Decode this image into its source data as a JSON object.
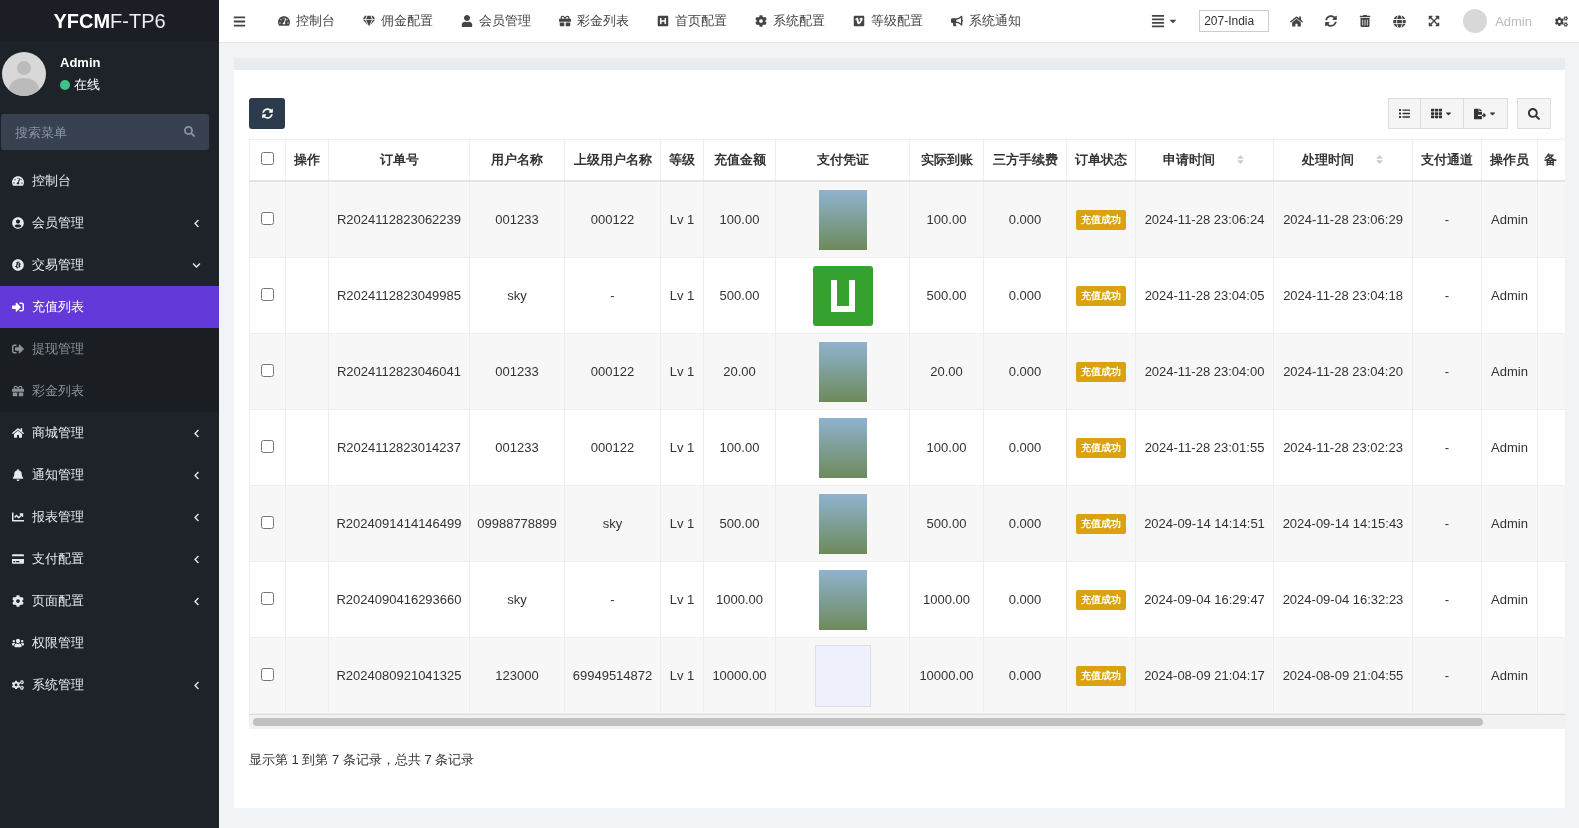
{
  "sidebar": {
    "logo": {
      "bold": "YFCM",
      "light": "F-TP6"
    },
    "user": {
      "name": "Admin",
      "status": "在线"
    },
    "search": {
      "placeholder": "搜索菜单"
    },
    "items": [
      {
        "label": "控制台",
        "kind": "link",
        "selected": false
      },
      {
        "label": "会员管理",
        "kind": "group",
        "expanded": false,
        "selected": false
      },
      {
        "label": "交易管理",
        "kind": "group",
        "expanded": true,
        "selected": false,
        "children": [
          {
            "label": "充值列表",
            "selected": true
          },
          {
            "label": "提现管理",
            "selected": false
          },
          {
            "label": "彩金列表",
            "selected": false
          }
        ]
      },
      {
        "label": "商城管理",
        "kind": "group",
        "expanded": false,
        "selected": false
      },
      {
        "label": "通知管理",
        "kind": "group",
        "expanded": false,
        "selected": false
      },
      {
        "label": "报表管理",
        "kind": "group",
        "expanded": false,
        "selected": false
      },
      {
        "label": "支付配置",
        "kind": "group",
        "expanded": false,
        "selected": false
      },
      {
        "label": "页面配置",
        "kind": "group",
        "expanded": false,
        "selected": false
      },
      {
        "label": "权限管理",
        "kind": "link",
        "selected": false
      },
      {
        "label": "系统管理",
        "kind": "group",
        "expanded": false,
        "selected": false
      }
    ]
  },
  "topbar": {
    "nav": [
      "控制台",
      "佣金配置",
      "会员管理",
      "彩金列表",
      "首页配置",
      "系统配置",
      "等级配置",
      "系统通知"
    ],
    "site_value": "207-India",
    "user": "Admin"
  },
  "table": {
    "columns": [
      {
        "label": "操作",
        "sortable": false
      },
      {
        "label": "订单号",
        "sortable": false
      },
      {
        "label": "用户名称",
        "sortable": false
      },
      {
        "label": "上级用户名称",
        "sortable": false
      },
      {
        "label": "等级",
        "sortable": false
      },
      {
        "label": "充值金额",
        "sortable": false
      },
      {
        "label": "支付凭证",
        "sortable": false
      },
      {
        "label": "实际到账",
        "sortable": false
      },
      {
        "label": "三方手续费",
        "sortable": false
      },
      {
        "label": "订单状态",
        "sortable": false
      },
      {
        "label": "申请时间",
        "sortable": true
      },
      {
        "label": "处理时间",
        "sortable": true
      },
      {
        "label": "支付通道",
        "sortable": false
      },
      {
        "label": "操作员",
        "sortable": false
      },
      {
        "label": "备",
        "sortable": false
      }
    ],
    "all_checked": false,
    "rows": [
      {
        "checked": false,
        "order": "R2024112823062239",
        "user": "001233",
        "parent": "000122",
        "level": "Lv 1",
        "amount": "100.00",
        "proof": {
          "kind": "photo"
        },
        "actual": "100.00",
        "fee": "0.000",
        "status": "充值成功",
        "applied": "2024-11-28 23:06:24",
        "processed": "2024-11-28 23:06:29",
        "channel": "-",
        "operator": "Admin"
      },
      {
        "checked": false,
        "order": "R2024112823049985",
        "user": "sky",
        "parent": "-",
        "level": "Lv 1",
        "amount": "500.00",
        "proof": {
          "kind": "logo"
        },
        "actual": "500.00",
        "fee": "0.000",
        "status": "充值成功",
        "applied": "2024-11-28 23:04:05",
        "processed": "2024-11-28 23:04:18",
        "channel": "-",
        "operator": "Admin"
      },
      {
        "checked": false,
        "order": "R2024112823046041",
        "user": "001233",
        "parent": "000122",
        "level": "Lv 1",
        "amount": "20.00",
        "proof": {
          "kind": "photo"
        },
        "actual": "20.00",
        "fee": "0.000",
        "status": "充值成功",
        "applied": "2024-11-28 23:04:00",
        "processed": "2024-11-28 23:04:20",
        "channel": "-",
        "operator": "Admin"
      },
      {
        "checked": false,
        "order": "R2024112823014237",
        "user": "001233",
        "parent": "000122",
        "level": "Lv 1",
        "amount": "100.00",
        "proof": {
          "kind": "photo"
        },
        "actual": "100.00",
        "fee": "0.000",
        "status": "充值成功",
        "applied": "2024-11-28 23:01:55",
        "processed": "2024-11-28 23:02:23",
        "channel": "-",
        "operator": "Admin"
      },
      {
        "checked": false,
        "order": "R2024091414146499",
        "user": "09988778899",
        "parent": "sky",
        "level": "Lv 1",
        "amount": "500.00",
        "proof": {
          "kind": "photo"
        },
        "actual": "500.00",
        "fee": "0.000",
        "status": "充值成功",
        "applied": "2024-09-14 14:14:51",
        "processed": "2024-09-14 14:15:43",
        "channel": "-",
        "operator": "Admin"
      },
      {
        "checked": false,
        "order": "R2024090416293660",
        "user": "sky",
        "parent": "-",
        "level": "Lv 1",
        "amount": "1000.00",
        "proof": {
          "kind": "photo"
        },
        "actual": "1000.00",
        "fee": "0.000",
        "status": "充值成功",
        "applied": "2024-09-04 16:29:47",
        "processed": "2024-09-04 16:32:23",
        "channel": "-",
        "operator": "Admin"
      },
      {
        "checked": false,
        "order": "R2024080921041325",
        "user": "123000",
        "parent": "69949514872",
        "level": "Lv 1",
        "amount": "10000.00",
        "proof": {
          "kind": "screenshot"
        },
        "actual": "10000.00",
        "fee": "0.000",
        "status": "充值成功",
        "applied": "2024-08-09 21:04:17",
        "processed": "2024-08-09 21:04:55",
        "channel": "-",
        "operator": "Admin"
      }
    ],
    "summary": "显示第 1 到第 7 条记录，总共 7 条记录"
  }
}
